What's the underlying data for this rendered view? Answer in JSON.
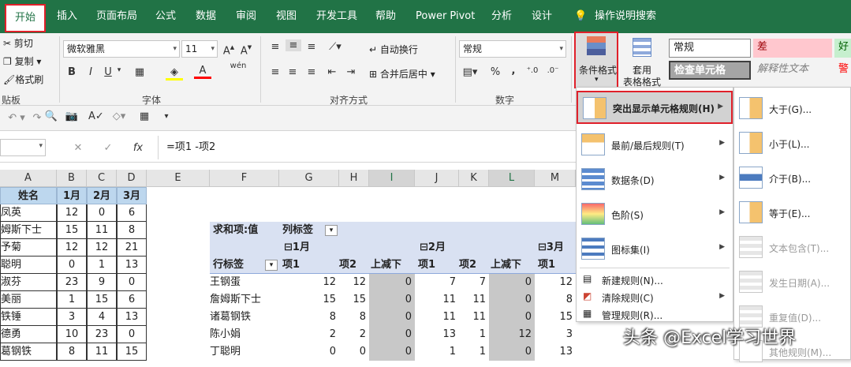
{
  "tabs": [
    "开始",
    "插入",
    "页面布局",
    "公式",
    "数据",
    "审阅",
    "视图",
    "开发工具",
    "帮助",
    "Power Pivot",
    "分析",
    "设计"
  ],
  "tell_me": "操作说明搜索",
  "clipboard": {
    "cut": "剪切",
    "copy": "复制",
    "format_painter": "格式刷",
    "label": "贴板"
  },
  "font": {
    "name": "微软雅黑",
    "size": "11",
    "label": "字体",
    "bold": "B",
    "italic": "I",
    "underline": "U",
    "font_color_glyph": "A",
    "phonetic": "wén"
  },
  "alignment": {
    "wrap": "自动换行",
    "merge": "合并后居中",
    "label": "对齐方式"
  },
  "number": {
    "format": "常规",
    "label": "数字",
    "percent": "%",
    "comma": ","
  },
  "cond_format": {
    "label": "条件格式"
  },
  "table_format": {
    "label1": "套用",
    "label2": "表格格式"
  },
  "styles": {
    "normal": "常规",
    "bad": "差",
    "good": "好",
    "check_cell": "检查单元格",
    "explanatory": "解释性文本",
    "warning": "警"
  },
  "formula_bar": {
    "fx": "fx",
    "formula": "=项1 -项2"
  },
  "columns": [
    "A",
    "B",
    "C",
    "D",
    "E",
    "F",
    "G",
    "H",
    "I",
    "J",
    "K",
    "L",
    "M"
  ],
  "table_left": {
    "headers": [
      "姓名",
      "1月",
      "2月",
      "3月"
    ],
    "rows": [
      [
        "凤英",
        "12",
        "0",
        "6"
      ],
      [
        "姆斯下士",
        "15",
        "11",
        "8"
      ],
      [
        "予菊",
        "12",
        "12",
        "21"
      ],
      [
        "聪明",
        "0",
        "1",
        "13"
      ],
      [
        "淑芬",
        "23",
        "9",
        "0"
      ],
      [
        "美丽",
        "1",
        "15",
        "6"
      ],
      [
        "铁锤",
        "3",
        "4",
        "13"
      ],
      [
        "德勇",
        "10",
        "23",
        "0"
      ],
      [
        "葛钢铁",
        "8",
        "11",
        "15"
      ]
    ]
  },
  "pivot": {
    "sum_label": "求和项:值",
    "col_label": "列标签",
    "months": [
      "⊟1月",
      "⊟2月",
      "⊟3月"
    ],
    "row_label": "行标签",
    "sub_headers": [
      "项1",
      "项2",
      "上减下",
      "项1",
      "项2",
      "上减下",
      "项1"
    ],
    "rows": [
      {
        "name": "王钢蛋",
        "v": [
          "12",
          "12",
          "0",
          "7",
          "7",
          "0",
          "12"
        ]
      },
      {
        "name": "詹姆斯下士",
        "v": [
          "15",
          "15",
          "0",
          "11",
          "11",
          "0",
          "8"
        ]
      },
      {
        "name": "诸葛钢铁",
        "v": [
          "8",
          "8",
          "0",
          "11",
          "11",
          "0",
          "15"
        ]
      },
      {
        "name": "陈小娟",
        "v": [
          "2",
          "2",
          "0",
          "13",
          "1",
          "12",
          "3"
        ]
      },
      {
        "name": "丁聪明",
        "v": [
          "0",
          "0",
          "0",
          "1",
          "1",
          "0",
          "13"
        ]
      }
    ],
    "extra": [
      "3",
      "13",
      "0"
    ]
  },
  "menu": {
    "items": [
      {
        "label": "突出显示单元格规则(H)"
      },
      {
        "label": "最前/最后规则(T)"
      },
      {
        "label": "数据条(D)"
      },
      {
        "label": "色阶(S)"
      },
      {
        "label": "图标集(I)"
      }
    ],
    "small_items": [
      "新建规则(N)...",
      "清除规则(C)",
      "管理规则(R)..."
    ]
  },
  "submenu": {
    "items": [
      "大于(G)...",
      "小于(L)...",
      "介于(B)...",
      "等于(E)...",
      "文本包含(T)...",
      "发生日期(A)...",
      "重复值(D)...",
      "其他规则(M)..."
    ]
  },
  "watermark": "头条 @Excel学习世界",
  "colors": {
    "excel_green": "#217346",
    "highlight_red": "#e0202a",
    "header_blue": "#bdd7ee",
    "pivot_blue": "#d9e1f2",
    "gray": "#c8c8c8"
  }
}
